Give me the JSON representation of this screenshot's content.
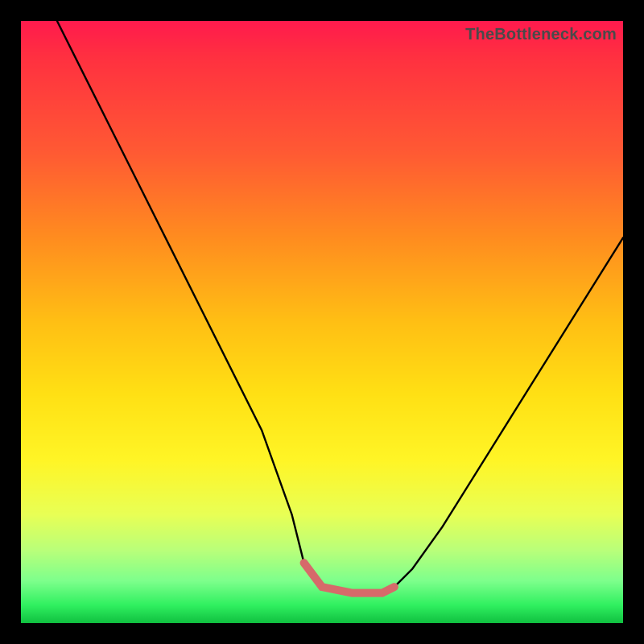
{
  "watermark": "TheBottleneck.com",
  "colors": {
    "frame": "#000000",
    "curve": "#000000",
    "accent_band": "#d66a6a",
    "gradient_stops": [
      "#ff1a4d",
      "#ff3040",
      "#ff5a33",
      "#ff8c1f",
      "#ffbf14",
      "#ffe014",
      "#fff526",
      "#e8ff55",
      "#b8ff7a",
      "#7dff8c",
      "#30f060",
      "#10c040"
    ]
  },
  "chart_data": {
    "type": "line",
    "title": "",
    "xlabel": "",
    "ylabel": "",
    "xlim": [
      0,
      100
    ],
    "ylim": [
      0,
      100
    ],
    "grid": false,
    "legend_position": "none",
    "annotations": [
      "TheBottleneck.com"
    ],
    "series": [
      {
        "name": "curve",
        "x": [
          6,
          10,
          15,
          20,
          25,
          30,
          35,
          40,
          45,
          47,
          50,
          55,
          58,
          60,
          62,
          65,
          70,
          75,
          80,
          85,
          90,
          95,
          100
        ],
        "y": [
          100,
          92,
          82,
          72,
          62,
          52,
          42,
          32,
          18,
          10,
          6,
          5,
          5,
          5,
          6,
          9,
          16,
          24,
          32,
          40,
          48,
          56,
          64
        ]
      },
      {
        "name": "accent-band",
        "x": [
          47,
          50,
          55,
          58,
          60,
          62
        ],
        "y": [
          10,
          6,
          5,
          5,
          5,
          6
        ]
      }
    ]
  }
}
